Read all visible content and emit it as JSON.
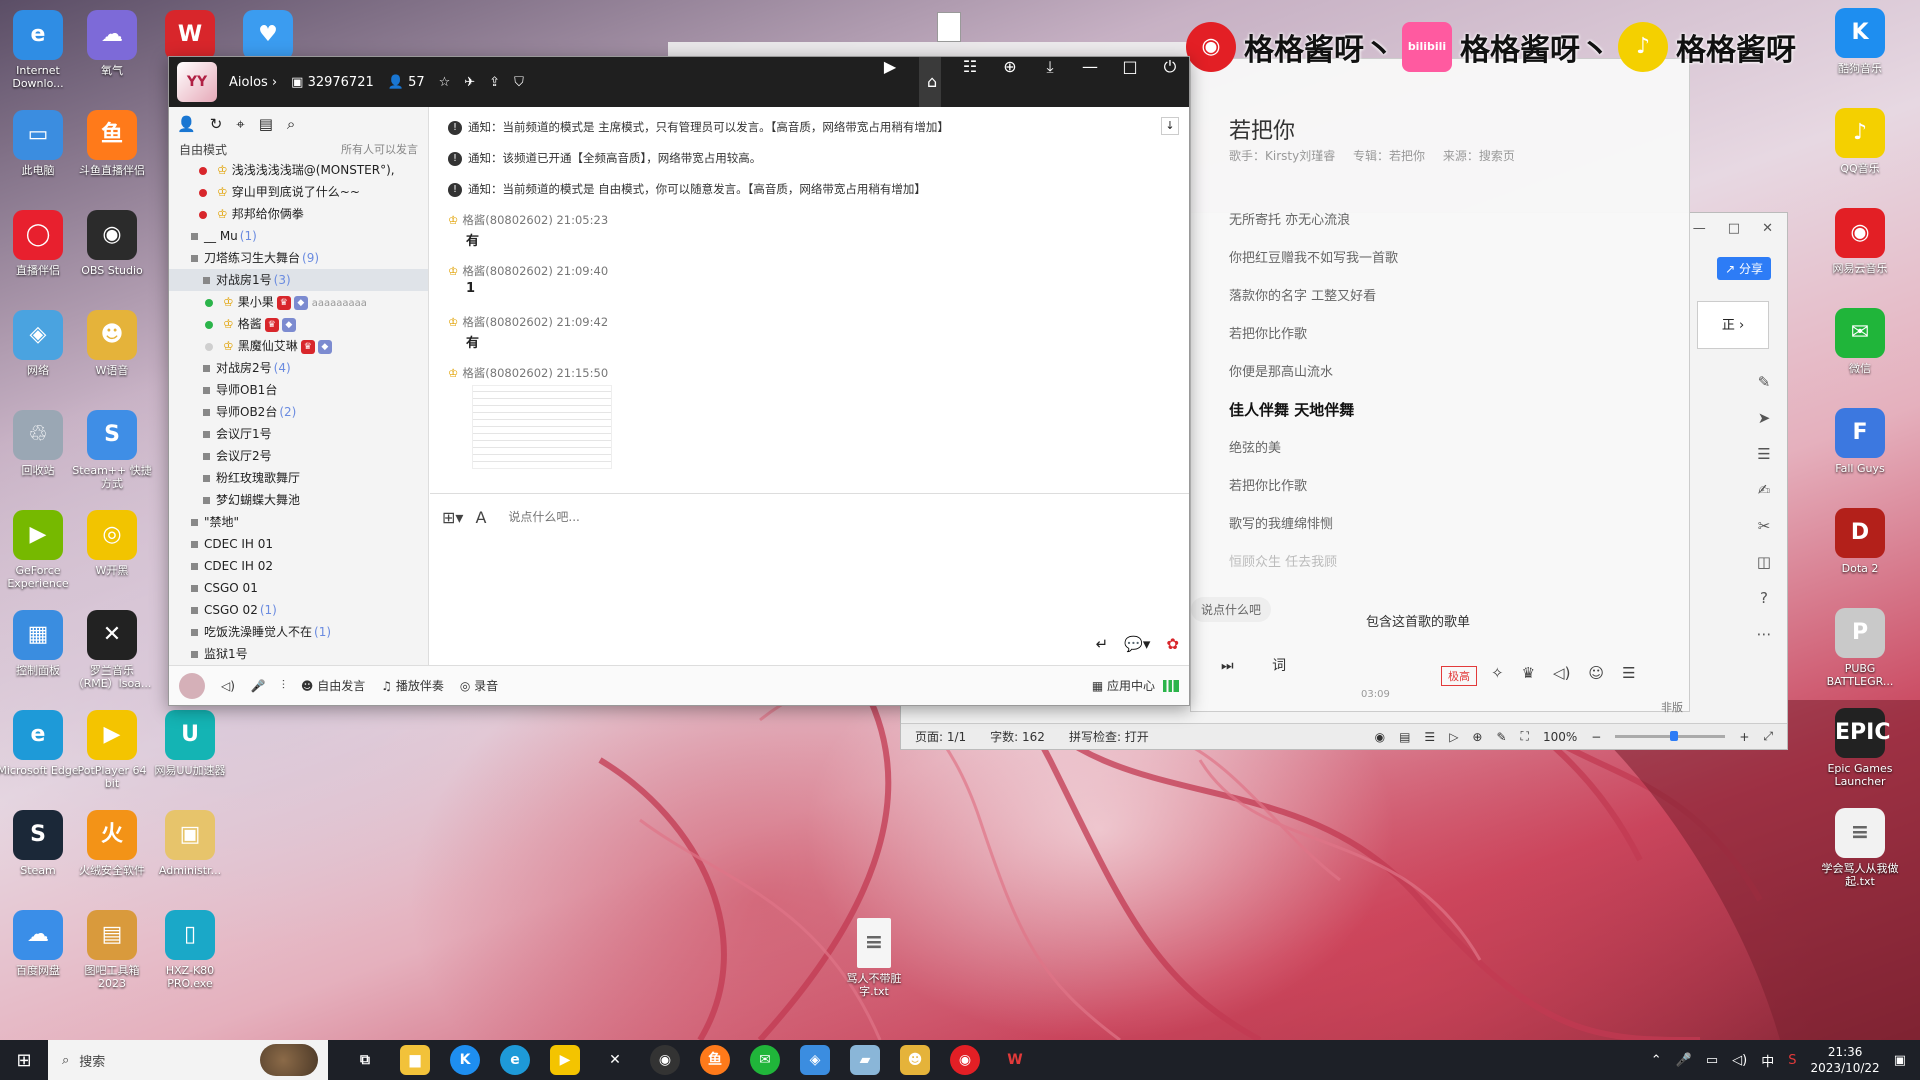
{
  "desktop_left_icons": [
    {
      "id": "ie",
      "label": "Internet Downlo...",
      "glyph": "e",
      "color": "#2f8de4"
    },
    {
      "id": "weather",
      "label": "氧气",
      "glyph": "☁",
      "color": "#7d6ad8"
    },
    {
      "id": "wps",
      "label": "W",
      "glyph": "W",
      "color": "#d8262b"
    },
    {
      "id": "heart",
      "label": "",
      "glyph": "♥",
      "color": "#3b9cf0"
    },
    {
      "id": "pc",
      "label": "此电脑",
      "glyph": "▭",
      "color": "#3b8de0"
    },
    {
      "id": "douyu",
      "label": "斗鱼直播伴侣",
      "glyph": "鱼",
      "color": "#ff7a1a"
    },
    {
      "id": "live",
      "label": "直播伴侣",
      "glyph": "◯",
      "color": "#e8202e"
    },
    {
      "id": "obs",
      "label": "OBS Studio",
      "glyph": "◉",
      "color": "#2b2b2b"
    },
    {
      "id": "network",
      "label": "网络",
      "glyph": "◈",
      "color": "#4aa3e0"
    },
    {
      "id": "wvoice",
      "label": "W语音",
      "glyph": "☻",
      "color": "#e5b33a"
    },
    {
      "id": "recycle",
      "label": "回收站",
      "glyph": "♲",
      "color": "#9aa7b4"
    },
    {
      "id": "steampp",
      "label": "Steam++ 快捷方式",
      "glyph": "S",
      "color": "#3f8ee6"
    },
    {
      "id": "geforce",
      "label": "GeForce Experience",
      "glyph": "▶",
      "color": "#76b900"
    },
    {
      "id": "wkaihei",
      "label": "W开黑",
      "glyph": "◎",
      "color": "#f2c400"
    },
    {
      "id": "control",
      "label": "控制面板",
      "glyph": "▦",
      "color": "#3a8de0"
    },
    {
      "id": "hyper",
      "label": "罗兰音乐（RME）lsoa...",
      "glyph": "✕",
      "color": "#222"
    },
    {
      "id": "edge",
      "label": "Microsoft Edge",
      "glyph": "e",
      "color": "#1e9ad8"
    },
    {
      "id": "potplayer",
      "label": "PotPlayer 64 bit",
      "glyph": "▶",
      "color": "#f4c400"
    },
    {
      "id": "uu",
      "label": "网易UU加速器",
      "glyph": "U",
      "color": "#14b4b4"
    },
    {
      "id": "steam",
      "label": "Steam",
      "glyph": "S",
      "color": "#1b2838"
    },
    {
      "id": "huorong",
      "label": "火绒安全软件",
      "glyph": "火",
      "color": "#f39317"
    },
    {
      "id": "admin",
      "label": "Administr...",
      "glyph": "▣",
      "color": "#e7c46b"
    },
    {
      "id": "baidu",
      "label": "百度网盘",
      "glyph": "☁",
      "color": "#3a8ee8"
    },
    {
      "id": "tools",
      "label": "图吧工具箱 2023",
      "glyph": "▤",
      "color": "#d99a3c"
    },
    {
      "id": "hxz",
      "label": "HXZ-K80 PRO.exe",
      "glyph": "▯",
      "color": "#1aa8c8"
    }
  ],
  "desktop_right_icons": [
    {
      "id": "kugou",
      "label": "酷狗音乐",
      "glyph": "K",
      "color": "#1e8ef0"
    },
    {
      "id": "qqmusic",
      "label": "QQ音乐",
      "glyph": "♪",
      "color": "#f4d000"
    },
    {
      "id": "netease",
      "label": "网易云音乐",
      "glyph": "◉",
      "color": "#e31f25"
    },
    {
      "id": "wechat",
      "label": "微信",
      "glyph": "✉",
      "color": "#20b53a"
    },
    {
      "id": "fallguys",
      "label": "Fall Guys",
      "glyph": "F",
      "color": "#3c78e0"
    },
    {
      "id": "dota",
      "label": "Dota 2",
      "glyph": "D",
      "color": "#b3201a"
    },
    {
      "id": "pubg",
      "label": "PUBG BATTLEGR...",
      "glyph": "P",
      "color": "#c9c9c9"
    },
    {
      "id": "epic",
      "label": "Epic Games Launcher",
      "glyph": "EPIC",
      "color": "#222"
    },
    {
      "id": "txt",
      "label": "学会骂人从我做起.txt",
      "glyph": "≡",
      "color": "#f2f2f2"
    }
  ],
  "desktop_bottom_file": {
    "label": "骂人不带脏字.txt"
  },
  "banner": {
    "items": [
      "格格酱呀丶",
      "格格酱呀丶",
      "格格酱呀"
    ],
    "logos": [
      "◉",
      "bilibili",
      "♪"
    ]
  },
  "yy": {
    "app_logo": "YY",
    "channel_name": "Aiolos",
    "channel_id": "32976721",
    "online_count": "57",
    "mode_label": "自由模式",
    "mode_right": "所有人可以发言",
    "tree": [
      {
        "type": "usr",
        "dot": "red",
        "text": "浅浅浅浅浅瑞@(MONSTER°),",
        "extra": ""
      },
      {
        "type": "usr",
        "dot": "red",
        "text": "穿山甲到底说了什么~~",
        "extra": ""
      },
      {
        "type": "usr",
        "dot": "red",
        "text": "邦邦给你俩拳",
        "extra": ""
      },
      {
        "type": "ch",
        "text": "__ Mu",
        "count": "(1)"
      },
      {
        "type": "ch",
        "text": "刀塔练习生大舞台",
        "count": "(9)"
      },
      {
        "type": "sub-sel",
        "text": "对战房1号",
        "count": "(3)"
      },
      {
        "type": "usr2",
        "dot": "green",
        "text": "果小果",
        "extra": "aaaaaaaaa"
      },
      {
        "type": "usr2",
        "dot": "green",
        "text": "格酱",
        "extra": ""
      },
      {
        "type": "usr2",
        "dot": "gray",
        "text": "黑魔仙艾琳",
        "extra": ""
      },
      {
        "type": "sub",
        "text": "对战房2号",
        "count": "(4)"
      },
      {
        "type": "sub",
        "text": "导师OB1台",
        "count": ""
      },
      {
        "type": "sub",
        "text": "导师OB2台",
        "count": "(2)"
      },
      {
        "type": "sub",
        "text": "会议厅1号",
        "count": ""
      },
      {
        "type": "sub",
        "text": "会议厅2号",
        "count": ""
      },
      {
        "type": "sub",
        "text": "粉红玫瑰歌舞厅",
        "count": ""
      },
      {
        "type": "sub",
        "text": "梦幻蝴蝶大舞池",
        "count": ""
      },
      {
        "type": "ch",
        "text": "\"禁地\"",
        "count": ""
      },
      {
        "type": "ch",
        "text": "CDEC IH 01",
        "count": ""
      },
      {
        "type": "ch",
        "text": "CDEC IH 02",
        "count": ""
      },
      {
        "type": "ch",
        "text": "CSGO 01",
        "count": ""
      },
      {
        "type": "ch",
        "text": "CSGO 02",
        "count": "(1)"
      },
      {
        "type": "ch",
        "text": "吃饭洗澡睡觉人不在",
        "count": "(1)"
      },
      {
        "type": "ch",
        "text": "监狱1号",
        "count": ""
      }
    ],
    "notices": [
      "通知：当前频道的模式是 主席模式，只有管理员可以发言。【高音质，网络带宽占用稍有增加】",
      "通知：该频道已开通【全频高音质】，网络带宽占用较高。",
      "通知：当前频道的模式是 自由模式，你可以随意发言。【高音质，网络带宽占用稍有增加】"
    ],
    "messages": [
      {
        "sender": "格酱(80802602)",
        "time": "21:05:23",
        "body": "有"
      },
      {
        "sender": "格酱(80802602)",
        "time": "21:09:40",
        "body": "1"
      },
      {
        "sender": "格酱(80802602)",
        "time": "21:09:42",
        "body": "有"
      },
      {
        "sender": "格酱(80802602)",
        "time": "21:15:50",
        "body": ""
      }
    ],
    "input_placeholder": "说点什么吧...",
    "bottom": {
      "free_speak": "自由发言",
      "accompany": "播放伴奏",
      "record": "录音",
      "app_center": "应用中心"
    }
  },
  "music": {
    "title": "若把你",
    "singer": "歌手：Kirsty刘瑾睿",
    "album": "专辑：若把你",
    "source": "来源：搜索页",
    "lyrics": [
      {
        "t": "无所寄托 亦无心流浪",
        "s": ""
      },
      {
        "t": "你把红豆赠我不如写我一首歌",
        "s": ""
      },
      {
        "t": "落款你的名字 工整又好看",
        "s": ""
      },
      {
        "t": "若把你比作歌",
        "s": ""
      },
      {
        "t": "你便是那高山流水",
        "s": ""
      },
      {
        "t": "佳人伴舞 天地伴舞",
        "s": "cur"
      },
      {
        "t": "绝弦的美",
        "s": ""
      },
      {
        "t": "若把你比作歌",
        "s": ""
      },
      {
        "t": "歌写的我缠绵悱恻",
        "s": ""
      },
      {
        "t": "恒顾众生 任去我顾",
        "s": "fade"
      }
    ],
    "chat_hint": "说点什么吧",
    "playlist": "包含这首歌的歌单",
    "lyric_btn": "词",
    "time": "03:09",
    "quality": "极高",
    "version": "非版"
  },
  "wps": {
    "share": "分享",
    "page": "页面: 1/1",
    "words": "字数: 162",
    "spell": "拼写检查: 打开",
    "zoom": "100%",
    "side_text": "正"
  },
  "taskbar": {
    "search": "搜索",
    "time": "21:36",
    "date": "2023/10/22",
    "ime": "中"
  }
}
